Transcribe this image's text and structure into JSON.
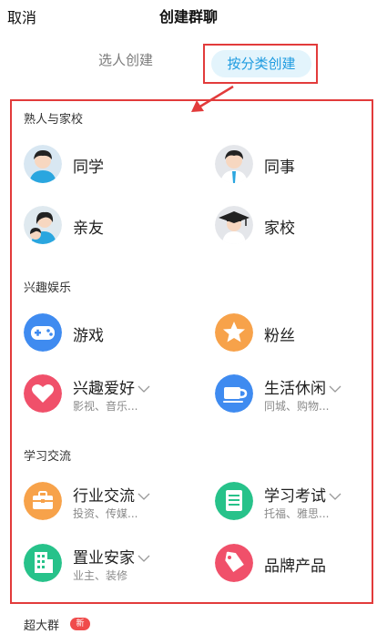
{
  "header": {
    "cancel_label": "取消",
    "title": "创建群聊"
  },
  "tabs": [
    {
      "label": "选人创建"
    },
    {
      "label": "按分类创建"
    }
  ],
  "sections": [
    {
      "title": "熟人与家校",
      "items": [
        {
          "label": "同学",
          "icon": "classmate-avatar-icon"
        },
        {
          "label": "同事",
          "icon": "colleague-avatar-icon"
        },
        {
          "label": "亲友",
          "icon": "family-avatar-icon"
        },
        {
          "label": "家校",
          "icon": "graduation-cap-icon"
        }
      ]
    },
    {
      "title": "兴趣娱乐",
      "items": [
        {
          "label": "游戏",
          "icon": "gamepad-icon"
        },
        {
          "label": "粉丝",
          "icon": "star-icon"
        },
        {
          "label": "兴趣爱好",
          "sub": "影视、音乐...",
          "icon": "heart-icon"
        },
        {
          "label": "生活休闲",
          "sub": "同城、购物...",
          "icon": "cup-icon"
        }
      ]
    },
    {
      "title": "学习交流",
      "items": [
        {
          "label": "行业交流",
          "sub": "投资、传媒...",
          "icon": "briefcase-icon"
        },
        {
          "label": "学习考试",
          "sub": "托福、雅思...",
          "icon": "document-icon"
        },
        {
          "label": "置业安家",
          "sub": "业主、装修",
          "icon": "building-icon"
        },
        {
          "label": "品牌产品",
          "icon": "tag-icon"
        }
      ]
    }
  ],
  "footer": {
    "label": "超大群",
    "badge": "新"
  },
  "colors": {
    "accent": "#1e9be0",
    "annotation_red": "#e23b3b",
    "game_blue": "#3f8bf0",
    "star_orange": "#f7a24a",
    "heart_red": "#f0506a",
    "cup_blue": "#3f8bf0",
    "briefcase_orange": "#f7a24a",
    "document_green": "#27c28a",
    "building_green": "#27c28a",
    "tag_red": "#f0506a"
  }
}
